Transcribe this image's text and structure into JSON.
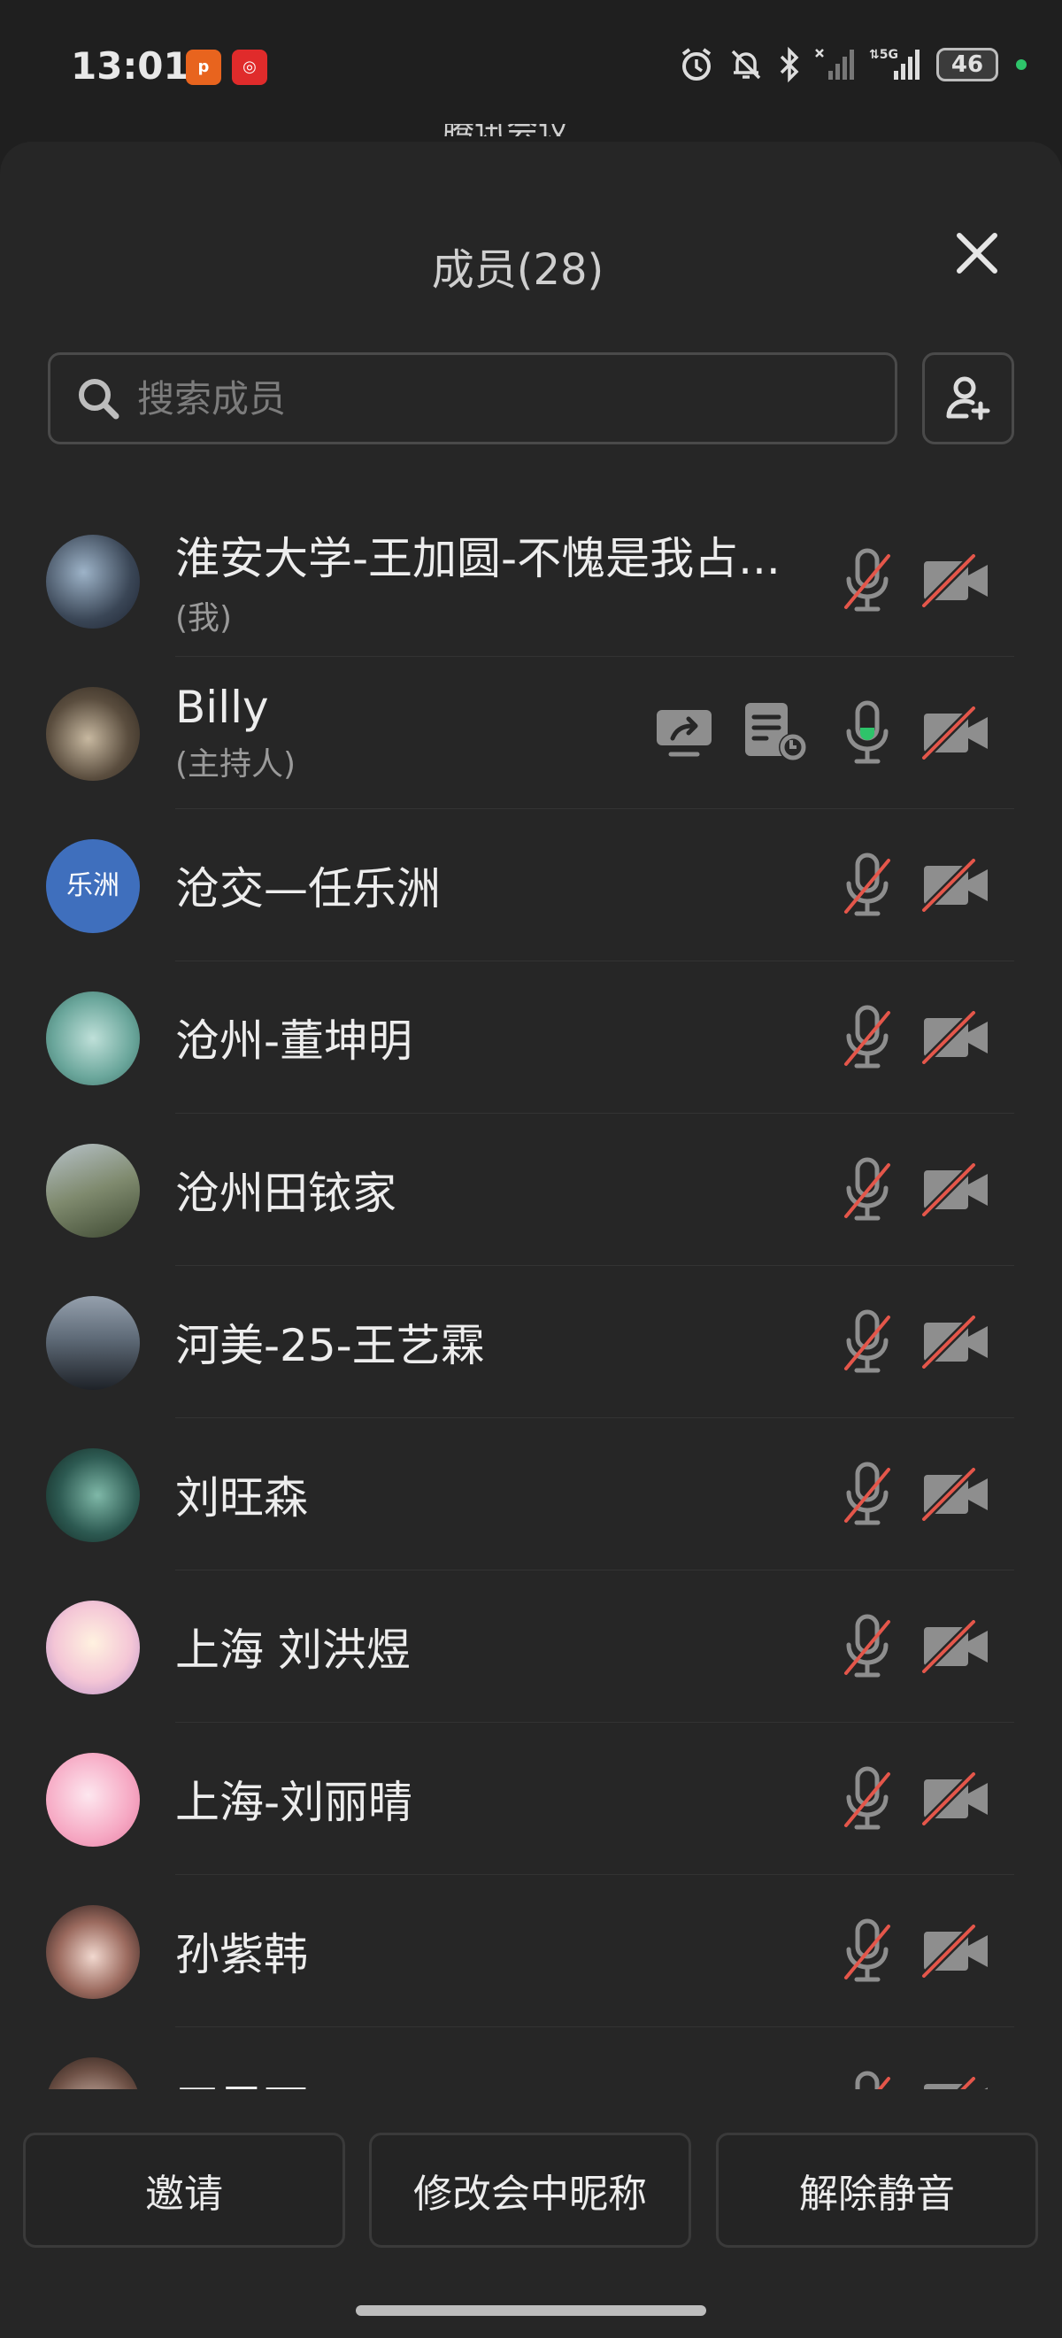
{
  "status_bar": {
    "time": "13:01",
    "app_badges": [
      "pdd-app-icon",
      "netease-music-icon"
    ],
    "icons": [
      "alarm-icon",
      "bell-off-icon",
      "bluetooth-icon",
      "signal-x-icon",
      "signal-5g-icon"
    ],
    "network_label": "5G",
    "battery": "46"
  },
  "behind_sheet_text": "腾讯会议",
  "sheet": {
    "title": "成员(28)",
    "search_placeholder": "搜索成员"
  },
  "members": [
    {
      "name": "淮安大学-王加圆-不愧是我占...",
      "sub": "(我)",
      "avatar": "photo-night-car",
      "mic": "muted",
      "cam": "off"
    },
    {
      "name": "Billy",
      "sub": "(主持人)",
      "avatar": "photo-reading",
      "mic": "on",
      "cam": "off",
      "extra_icons": [
        "screen-share-icon",
        "document-icon"
      ]
    },
    {
      "name": "沧交—任乐洲",
      "sub": "",
      "avatar_text": "乐洲",
      "mic": "muted",
      "cam": "off"
    },
    {
      "name": "沧州-董坤明",
      "sub": "",
      "avatar": "photo-book",
      "mic": "muted",
      "cam": "off"
    },
    {
      "name": "沧州田铱家",
      "sub": "",
      "avatar": "photo-outdoor",
      "mic": "muted",
      "cam": "off"
    },
    {
      "name": "河美-25-王艺霖",
      "sub": "",
      "avatar": "photo-silhouette",
      "mic": "muted",
      "cam": "off"
    },
    {
      "name": "刘旺森",
      "sub": "",
      "avatar": "photo-green-room",
      "mic": "muted",
      "cam": "off"
    },
    {
      "name": "上海 刘洪煜",
      "sub": "",
      "avatar": "photo-anime-girl",
      "mic": "muted",
      "cam": "off"
    },
    {
      "name": "上海-刘丽晴",
      "sub": "",
      "avatar": "photo-anime-pink",
      "mic": "muted",
      "cam": "off"
    },
    {
      "name": "孙紫韩",
      "sub": "",
      "avatar": "photo-girl",
      "mic": "muted",
      "cam": "off"
    },
    {
      "name": "王思雨",
      "sub": "",
      "avatar": "photo-partial",
      "mic": "muted",
      "cam": "off"
    }
  ],
  "buttons": {
    "invite": "邀请",
    "rename": "修改会中昵称",
    "unmute": "解除静音"
  },
  "colors": {
    "background": "#1f1f1f",
    "sheet": "#262626",
    "muted_slash": "#e4564a",
    "mic_on_accent": "#2ec46a",
    "text_avatar_bg": "#3f6fbd"
  }
}
